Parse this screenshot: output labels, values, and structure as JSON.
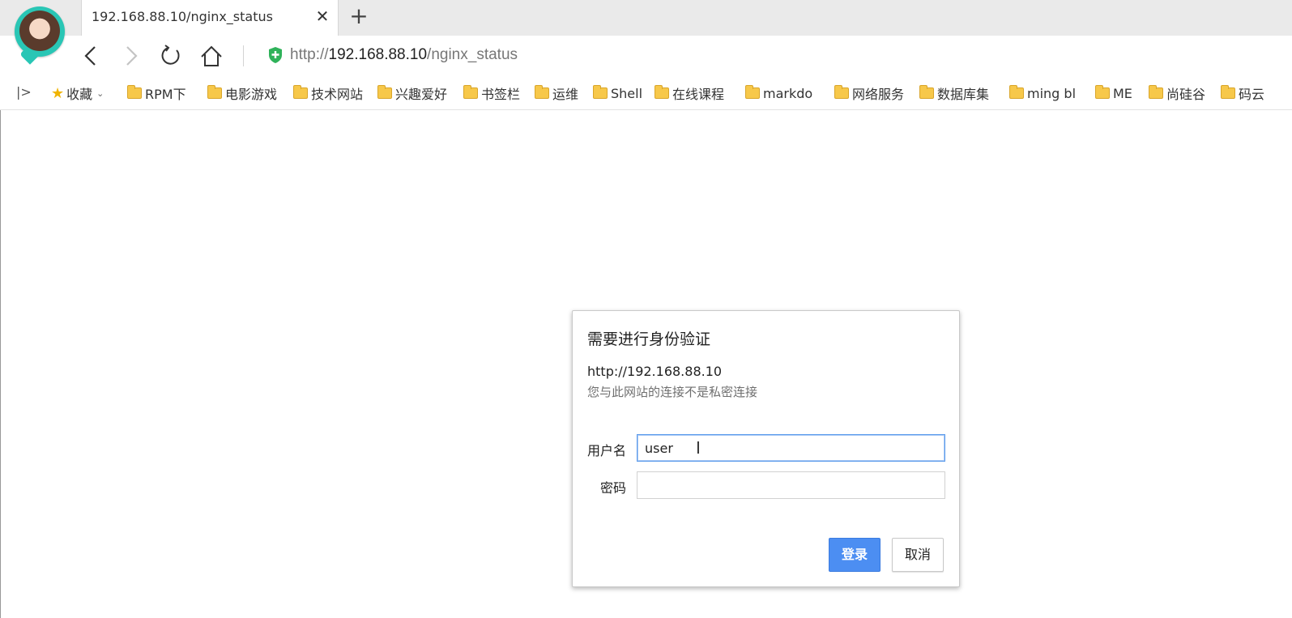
{
  "tab": {
    "title": "192.168.88.10/nginx_status",
    "close": "✕",
    "new_tab": "+"
  },
  "address_bar": {
    "scheme": "http://",
    "host": "192.168.88.10",
    "path": "/nginx_status"
  },
  "bookmarks": {
    "favorites_label": "收藏",
    "items": [
      "RPM下",
      "电影游戏",
      "技术网站",
      "兴趣爱好",
      "书签栏",
      "运维",
      "Shell",
      "在线课程",
      "markdo",
      "网络服务",
      "数据库集",
      "ming bl",
      "ME",
      "尚硅谷",
      "码云"
    ]
  },
  "dialog": {
    "title": "需要进行身份验证",
    "host": "http://192.168.88.10",
    "note": "您与此网站的连接不是私密连接",
    "username_label": "用户名",
    "username_value": "user",
    "password_label": "密码",
    "password_value": "",
    "login_button": "登录",
    "cancel_button": "取消"
  },
  "colors": {
    "primary_button": "#4c8ef2",
    "focus_border": "#5d9cec",
    "shield": "#2fb25a",
    "avatar_ring": "#29c6b5"
  }
}
